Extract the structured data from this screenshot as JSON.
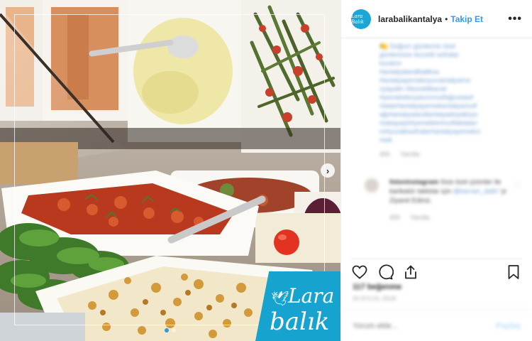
{
  "post": {
    "username": "larabalikantalya",
    "separator": "•",
    "follow_label": "Takip Et",
    "more_label": "•••",
    "avatar_text": "Lara Balık",
    "photo_alt": "Restaurant display counter with meze dishes",
    "carousel": {
      "total": 2,
      "active": 1
    },
    "brand_logo": {
      "line1": "Lara",
      "line2": "balık"
    }
  },
  "comments": {
    "caption_lines": [
      "🍋 Doğum günlerine özel",
      "günlerinize lezzetli sofralar",
      "kuralım",
      "#antalyalarafbaliksa",
      "#antalyayemekoyunantalyamo",
      "zyayalin #lezzetlikanat",
      "#yemekdünyasınımutfağıustaof",
      "rdalar#antalyayemekantalyamutf",
      "ağı#antalyalarafantalyadoyaklıyo",
      "makayaşlı#yemeklerimutfaktaları",
      "m#yuzakisofralar#antalyayemekci",
      "mek"
    ],
    "caption_meta": [
      "40h",
      "Yanıtla"
    ],
    "comment2": {
      "username": "fotoninstagram",
      "text": "Size özel çizimler ile karikatür tablolar için",
      "mention": "@karvan_dallri",
      "suffix": "'yi Ziyaret Ediniz.",
      "meta": [
        "40h",
        "Yanıtla"
      ]
    }
  },
  "footer": {
    "likes": "117 beğenme",
    "date": "20 EYLÜL 2018",
    "comment_placeholder": "Yorum ekle...",
    "post_label": "Paylaş"
  },
  "colors": {
    "accent": "#3897f0",
    "brand": "#16a3cf"
  }
}
